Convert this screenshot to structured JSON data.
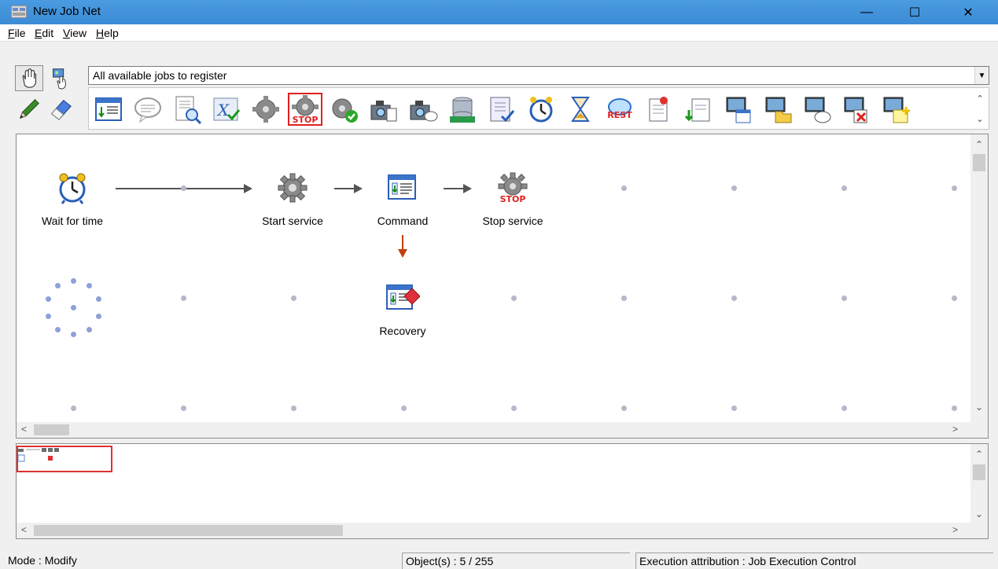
{
  "window": {
    "title": "New Job Net",
    "minimize_icon": "minimize-icon",
    "maximize_icon": "maximize-icon",
    "close_icon": "close-icon"
  },
  "menu": [
    "File",
    "Edit",
    "View",
    "Help"
  ],
  "modes": [
    "hand-icon",
    "link-icon",
    "pencil-icon",
    "eraser-icon"
  ],
  "job_filter": {
    "value": "All available jobs to register"
  },
  "palette": [
    "command-job-icon",
    "message-job-icon",
    "file-check-icon",
    "variable-job-icon",
    "start-service-icon",
    "stop-service-icon",
    "service-status-icon",
    "camera-file-icon",
    "camera-message-icon",
    "database-icon",
    "checklist-icon",
    "wait-for-time-icon",
    "hourglass-icon",
    "rest-job-icon",
    "upload-file-icon",
    "download-file-icon",
    "remote-command-icon",
    "remote-folder-icon",
    "remote-message-icon",
    "remote-delete-icon",
    "remote-new-icon"
  ],
  "nodes": {
    "wait": {
      "label": "Wait for time"
    },
    "start": {
      "label": "Start service"
    },
    "command": {
      "label": "Command"
    },
    "stop": {
      "label": "Stop service"
    },
    "recovery": {
      "label": "Recovery"
    }
  },
  "status": {
    "mode": "Mode : Modify",
    "objects": "Object(s) : 5 / 255",
    "execution": "Execution attribution : Job Execution Control"
  },
  "colors": {
    "titlebar": "#3c8bd6",
    "selection": "#e02020",
    "recovery_arrow": "#c04010"
  }
}
